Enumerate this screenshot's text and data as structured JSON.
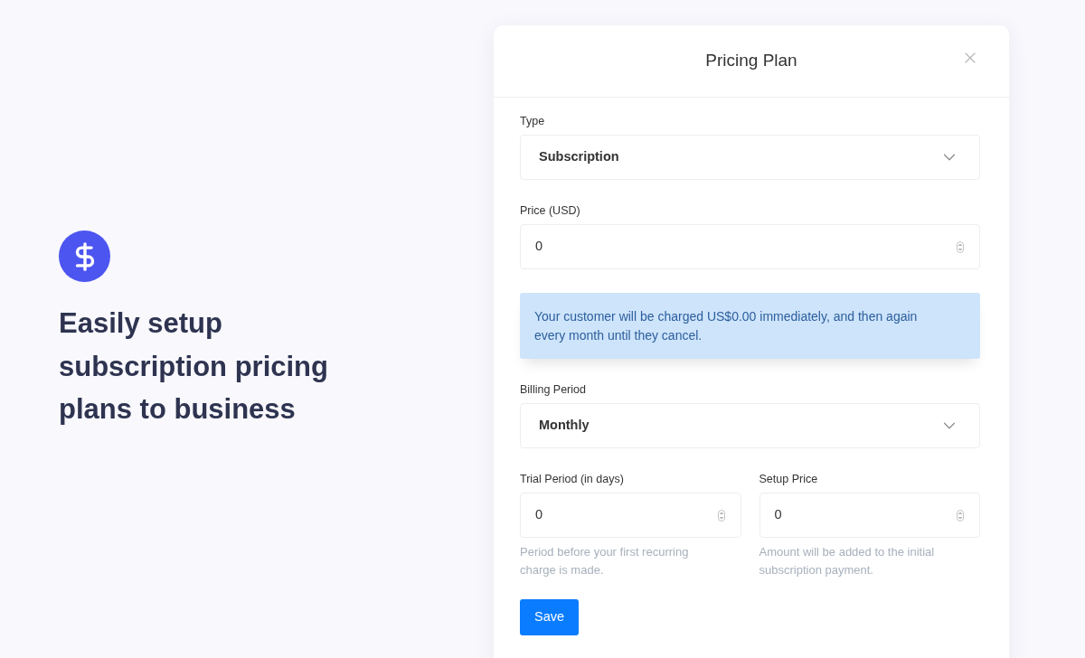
{
  "promo": {
    "heading": "Easily setup subscription pricing plans to business"
  },
  "dialog": {
    "title": "Pricing Plan",
    "fields": [
      {
        "kind": "select",
        "label": "Type",
        "value": "Subscription"
      },
      {
        "kind": "number",
        "label": "Price (USD)",
        "value": "0"
      },
      {
        "kind": "notice",
        "text": "Your customer will be charged US$0.00 immediately, and then again every month until they cancel."
      },
      {
        "kind": "select",
        "label": "Billing Period",
        "value": "Monthly"
      },
      {
        "kind": "row",
        "fields": [
          {
            "kind": "number",
            "label": "Trial Period (in days)",
            "value": "0",
            "help": "Period before your first recurring charge is made."
          },
          {
            "kind": "number",
            "label": "Setup Price",
            "value": "0",
            "help": "Amount will be added to the initial subscription payment."
          }
        ]
      }
    ],
    "save_button": "Save"
  }
}
